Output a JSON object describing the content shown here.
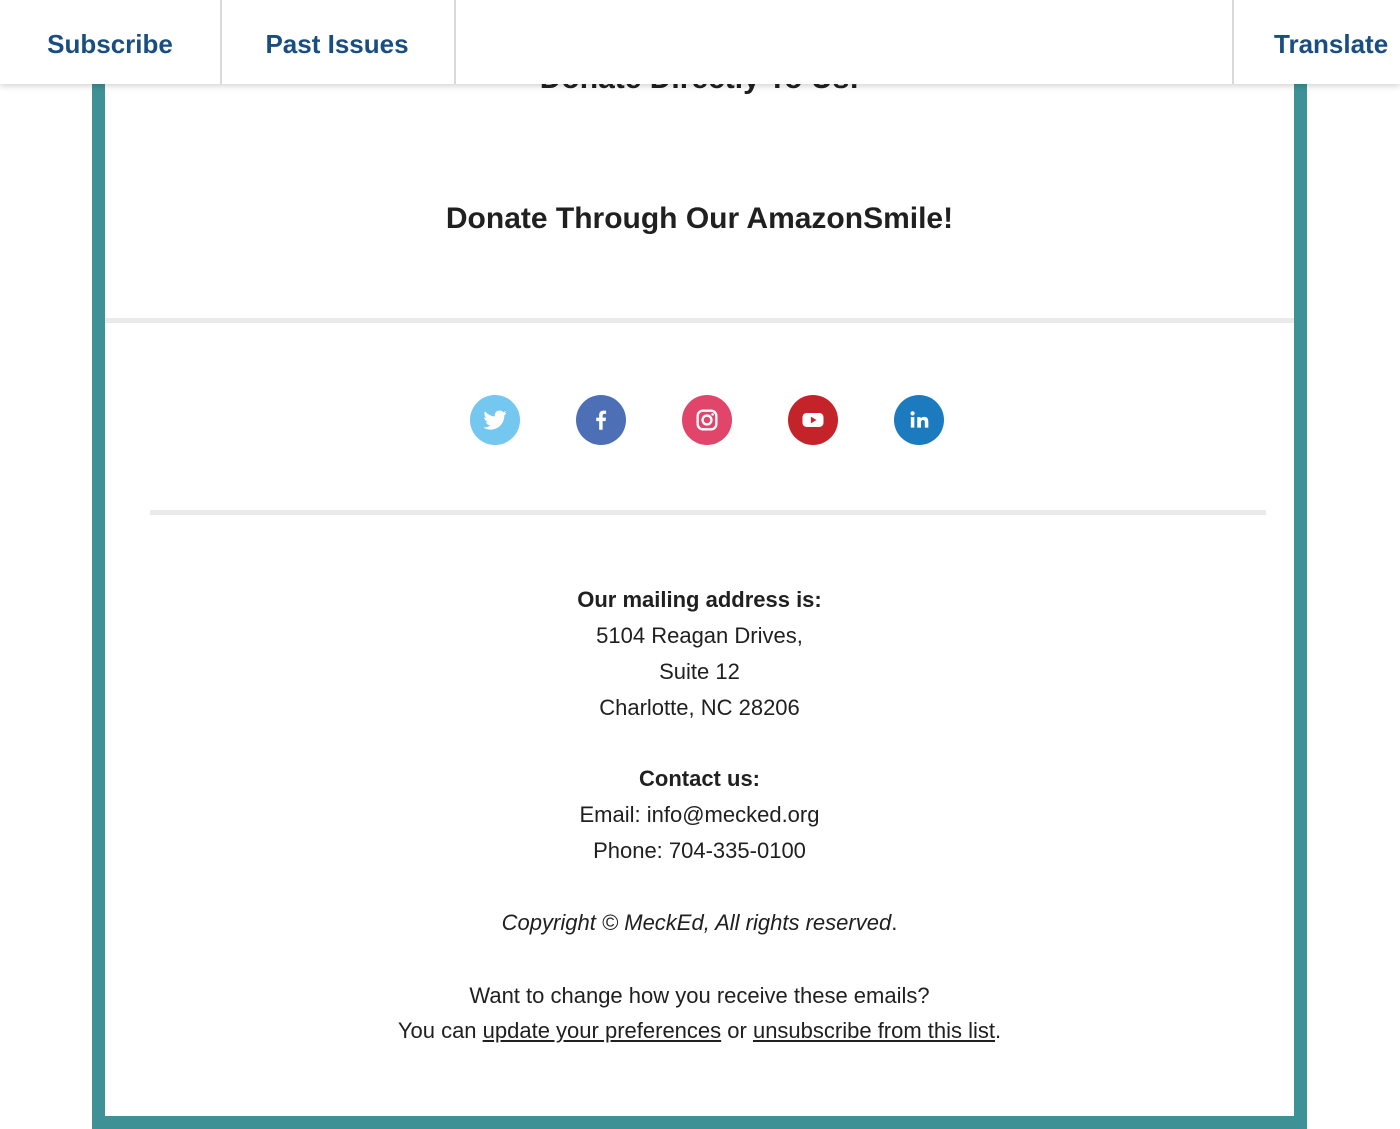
{
  "topbar": {
    "subscribe": "Subscribe",
    "past_issues": "Past Issues",
    "translate": "Translate"
  },
  "content": {
    "cutoff_heading": "Donate Directly To Us!",
    "amazon_link": "Donate Through Our AmazonSmile!"
  },
  "social": [
    {
      "name": "twitter-icon",
      "color": "#74c7ee"
    },
    {
      "name": "facebook-icon",
      "color": "#4d6fb6"
    },
    {
      "name": "instagram-icon",
      "color": "#e1466a"
    },
    {
      "name": "youtube-icon",
      "color": "#c5232a"
    },
    {
      "name": "linkedin-icon",
      "color": "#1c7bbf"
    }
  ],
  "footer": {
    "mailing_label": "Our mailing address is:",
    "address_line1": "5104 Reagan Drives,",
    "address_line2": "Suite 12",
    "address_line3": "Charlotte, NC 28206",
    "contact_label": "Contact us:",
    "email_line": "Email: info@mecked.org",
    "phone_line": "Phone: 704-335-0100",
    "copyright": "Copyright © MeckEd, All rights reserved",
    "copyright_end": ".",
    "change_prompt": "Want to change how you receive these emails?",
    "you_can": "You can ",
    "update_link": "update your preferences",
    "or": " or ",
    "unsubscribe_link": "unsubscribe from this list",
    "end_period": "."
  },
  "colors": {
    "accent_border": "#3e9296",
    "nav_text": "#1a4d80"
  }
}
